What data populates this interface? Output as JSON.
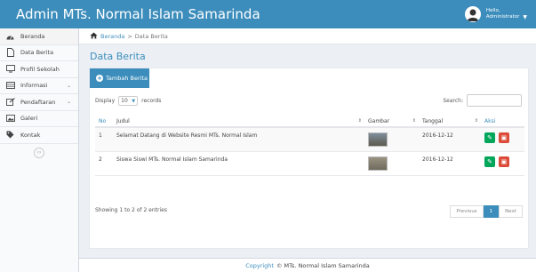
{
  "header": {
    "app_title": "Admin MTs. Normal Islam Samarinda",
    "user_greeting": "Hello,",
    "user_name": "Administrator"
  },
  "sidebar": {
    "items": [
      {
        "label": "Beranda",
        "icon": "dashboard-icon",
        "has_submenu": false
      },
      {
        "label": "Data Berita",
        "icon": "document-icon",
        "has_submenu": false
      },
      {
        "label": "Profil Sekolah",
        "icon": "monitor-icon",
        "has_submenu": false
      },
      {
        "label": "Informasi",
        "icon": "table-icon",
        "has_submenu": true
      },
      {
        "label": "Pendaftaran",
        "icon": "edit-icon",
        "has_submenu": true
      },
      {
        "label": "Galeri",
        "icon": "image-icon",
        "has_submenu": false
      },
      {
        "label": "Kontak",
        "icon": "tag-icon",
        "has_submenu": false
      }
    ]
  },
  "breadcrumb": {
    "home": "Beranda",
    "current": "Data Berita"
  },
  "page": {
    "title": "Data Berita",
    "add_button": "Tambah Berita"
  },
  "table_controls": {
    "display_label": "Display",
    "display_value": "10",
    "records_label": "records",
    "search_label": "Search:"
  },
  "table": {
    "columns": [
      "No",
      "Judul",
      "Gambar",
      "Tanggal",
      "Aksi"
    ],
    "rows": [
      {
        "no": "1",
        "judul": "Selamat Datang di Website Resmi MTs. Normal Islam",
        "tanggal": "2016-12-12"
      },
      {
        "no": "2",
        "judul": "Siswa Siswi MTs. Normal Islam Samarinda",
        "tanggal": "2016-12-12"
      }
    ]
  },
  "pagination": {
    "info": "Showing 1 to 2 of 2 entries",
    "previous": "Previous",
    "current": "1",
    "next": "Next"
  },
  "footer": {
    "copyright_word": "Copyright",
    "text": "© MTs. Normal Islam Samarinda"
  },
  "colors": {
    "header": "#3c8dbc",
    "edit": "#00a65a",
    "delete": "#dd4b39"
  }
}
